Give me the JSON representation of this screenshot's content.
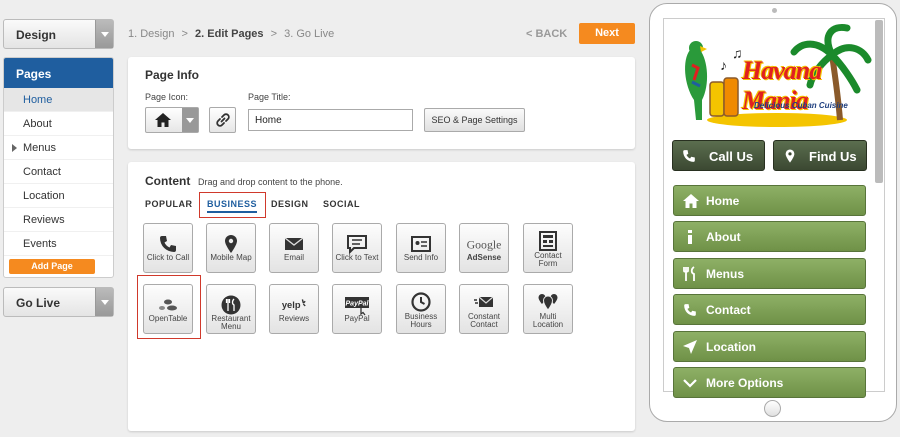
{
  "left": {
    "design_label": "Design",
    "pages_header": "Pages",
    "pages": [
      "Home",
      "About",
      "Menus",
      "Contact",
      "Location",
      "Reviews",
      "Events"
    ],
    "add_page": "Add Page",
    "golive_label": "Go Live"
  },
  "steps": {
    "s1": "1. Design",
    "sep1": ">",
    "s2": "2. Edit Pages",
    "sep2": ">",
    "s3": "3. Go Live"
  },
  "toolbar": {
    "back": "< BACK",
    "next": "Next"
  },
  "page_info": {
    "title": "Page Info",
    "icon_label": "Page Icon:",
    "title_label": "Page Title:",
    "title_value": "Home",
    "seo": "SEO & Page Settings"
  },
  "content": {
    "title": "Content",
    "hint": "Drag and drop content to the phone.",
    "tabs": [
      "POPULAR",
      "BUSINESS",
      "DESIGN",
      "SOCIAL"
    ],
    "row1": [
      "Click to Call",
      "Mobile Map",
      "Email",
      "Click to Text",
      "Send Info",
      "AdSense",
      "Contact Form"
    ],
    "row2": [
      "OpenTable",
      "Restaurant Menu",
      "Reviews",
      "PayPal",
      "Business Hours",
      "Constant Contact",
      "Multi Location"
    ]
  },
  "phone": {
    "logo_title": "Havana Mania",
    "logo_sub": "Delicious Cuban Cuisine",
    "call": "Call Us",
    "find": "Find Us",
    "nav": [
      "Home",
      "About",
      "Menus",
      "Contact",
      "Location",
      "More Options"
    ]
  },
  "colors": {
    "accent": "#f58a1f",
    "selected": "#1f5e9f",
    "nav_green": "#7ea257",
    "highlight": "#d0392b"
  }
}
